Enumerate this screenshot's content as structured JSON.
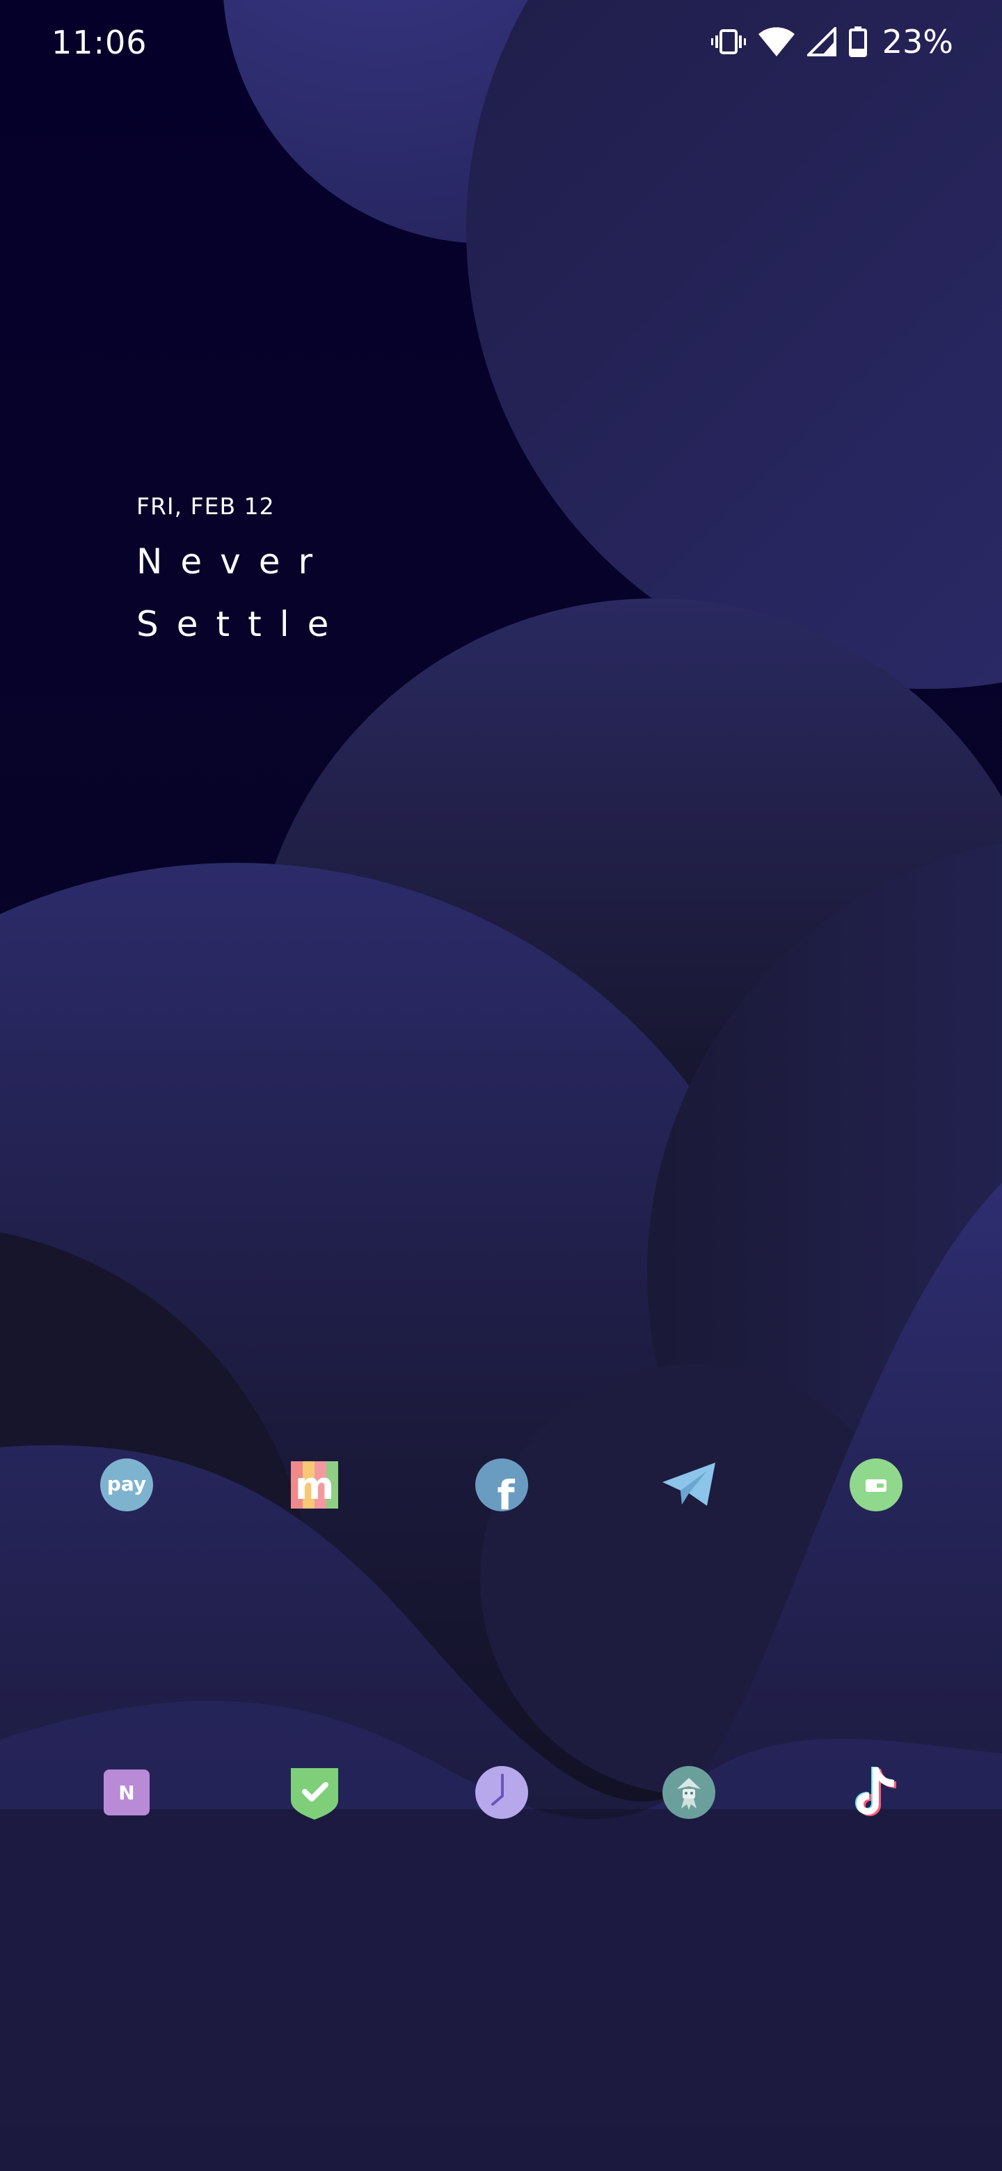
{
  "status_bar": {
    "time": "11:06",
    "battery_percent": "23%",
    "icons": [
      "vibrate-icon",
      "wifi-icon",
      "cellular-signal-icon",
      "battery-icon"
    ]
  },
  "clock_widget": {
    "date": "FRI, FEB 12",
    "line1": "Never",
    "line2": "Settle"
  },
  "home_apps": {
    "row1": [
      {
        "icon": "pay-app-icon",
        "glyph": "pay",
        "color": "#7eb3cf"
      },
      {
        "icon": "m-app-icon",
        "glyph": "m",
        "color": "#f08a8a"
      },
      {
        "icon": "facebook-app-icon",
        "glyph": "f",
        "color": "#6a9cc1"
      },
      {
        "icon": "telegram-app-icon",
        "glyph": "",
        "color": "#8cc4ea"
      },
      {
        "icon": "wallet-app-icon",
        "glyph": "",
        "color": "#8fd88c"
      }
    ],
    "row2": [
      {
        "icon": "n-app-icon",
        "glyph": "N",
        "color": "#b98bd6"
      },
      {
        "icon": "shield-check-app-icon",
        "glyph": "",
        "color": "#7fcf7a"
      },
      {
        "icon": "clock-app-icon",
        "glyph": "",
        "color": "#b7a8ec"
      },
      {
        "icon": "robot-app-icon",
        "glyph": "",
        "color": "#6b9f9c"
      },
      {
        "icon": "tiktok-app-icon",
        "glyph": "",
        "color": "#ffffff"
      }
    ]
  },
  "colors": {
    "background_dark": "#05002a",
    "shape_indigo": "#2b2a6a",
    "shape_deep": "#16142e"
  }
}
